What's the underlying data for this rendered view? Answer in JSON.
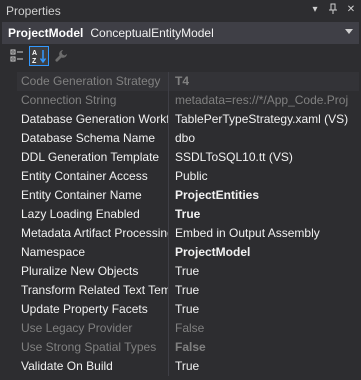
{
  "window": {
    "title": "Properties",
    "pin_glyph": "↓ Q",
    "dropdown_glyph": "▾",
    "close_glyph": "✕"
  },
  "object": {
    "name": "ProjectModel",
    "type": "ConceptualEntityModel"
  },
  "toolbar": {
    "icons": [
      "categorized-icon",
      "alphabetical-icon",
      "property-pages-icon"
    ]
  },
  "properties": [
    {
      "name": "Code Generation Strategy",
      "value": "T4",
      "disabled": true,
      "bold": true
    },
    {
      "name": "Connection String",
      "value": "metadata=res://*/App_Code.Proj",
      "disabled": true,
      "bold": false
    },
    {
      "name": "Database Generation Workfl",
      "value": "TablePerTypeStrategy.xaml (VS)",
      "disabled": false,
      "bold": false
    },
    {
      "name": "Database Schema Name",
      "value": "dbo",
      "disabled": false,
      "bold": false
    },
    {
      "name": "DDL Generation Template",
      "value": "SSDLToSQL10.tt (VS)",
      "disabled": false,
      "bold": false
    },
    {
      "name": "Entity Container Access",
      "value": "Public",
      "disabled": false,
      "bold": false
    },
    {
      "name": "Entity Container Name",
      "value": "ProjectEntities",
      "disabled": false,
      "bold": true
    },
    {
      "name": "Lazy Loading Enabled",
      "value": "True",
      "disabled": false,
      "bold": true
    },
    {
      "name": "Metadata Artifact Processing",
      "value": "Embed in Output Assembly",
      "disabled": false,
      "bold": false
    },
    {
      "name": "Namespace",
      "value": "ProjectModel",
      "disabled": false,
      "bold": true
    },
    {
      "name": "Pluralize New Objects",
      "value": "True",
      "disabled": false,
      "bold": false
    },
    {
      "name": "Transform Related Text Tem",
      "value": "True",
      "disabled": false,
      "bold": false
    },
    {
      "name": "Update Property Facets",
      "value": "True",
      "disabled": false,
      "bold": false
    },
    {
      "name": "Use Legacy Provider",
      "value": "False",
      "disabled": true,
      "bold": false
    },
    {
      "name": "Use Strong Spatial Types",
      "value": "False",
      "disabled": true,
      "bold": true
    },
    {
      "name": "Validate On Build",
      "value": "True",
      "disabled": false,
      "bold": false
    }
  ]
}
